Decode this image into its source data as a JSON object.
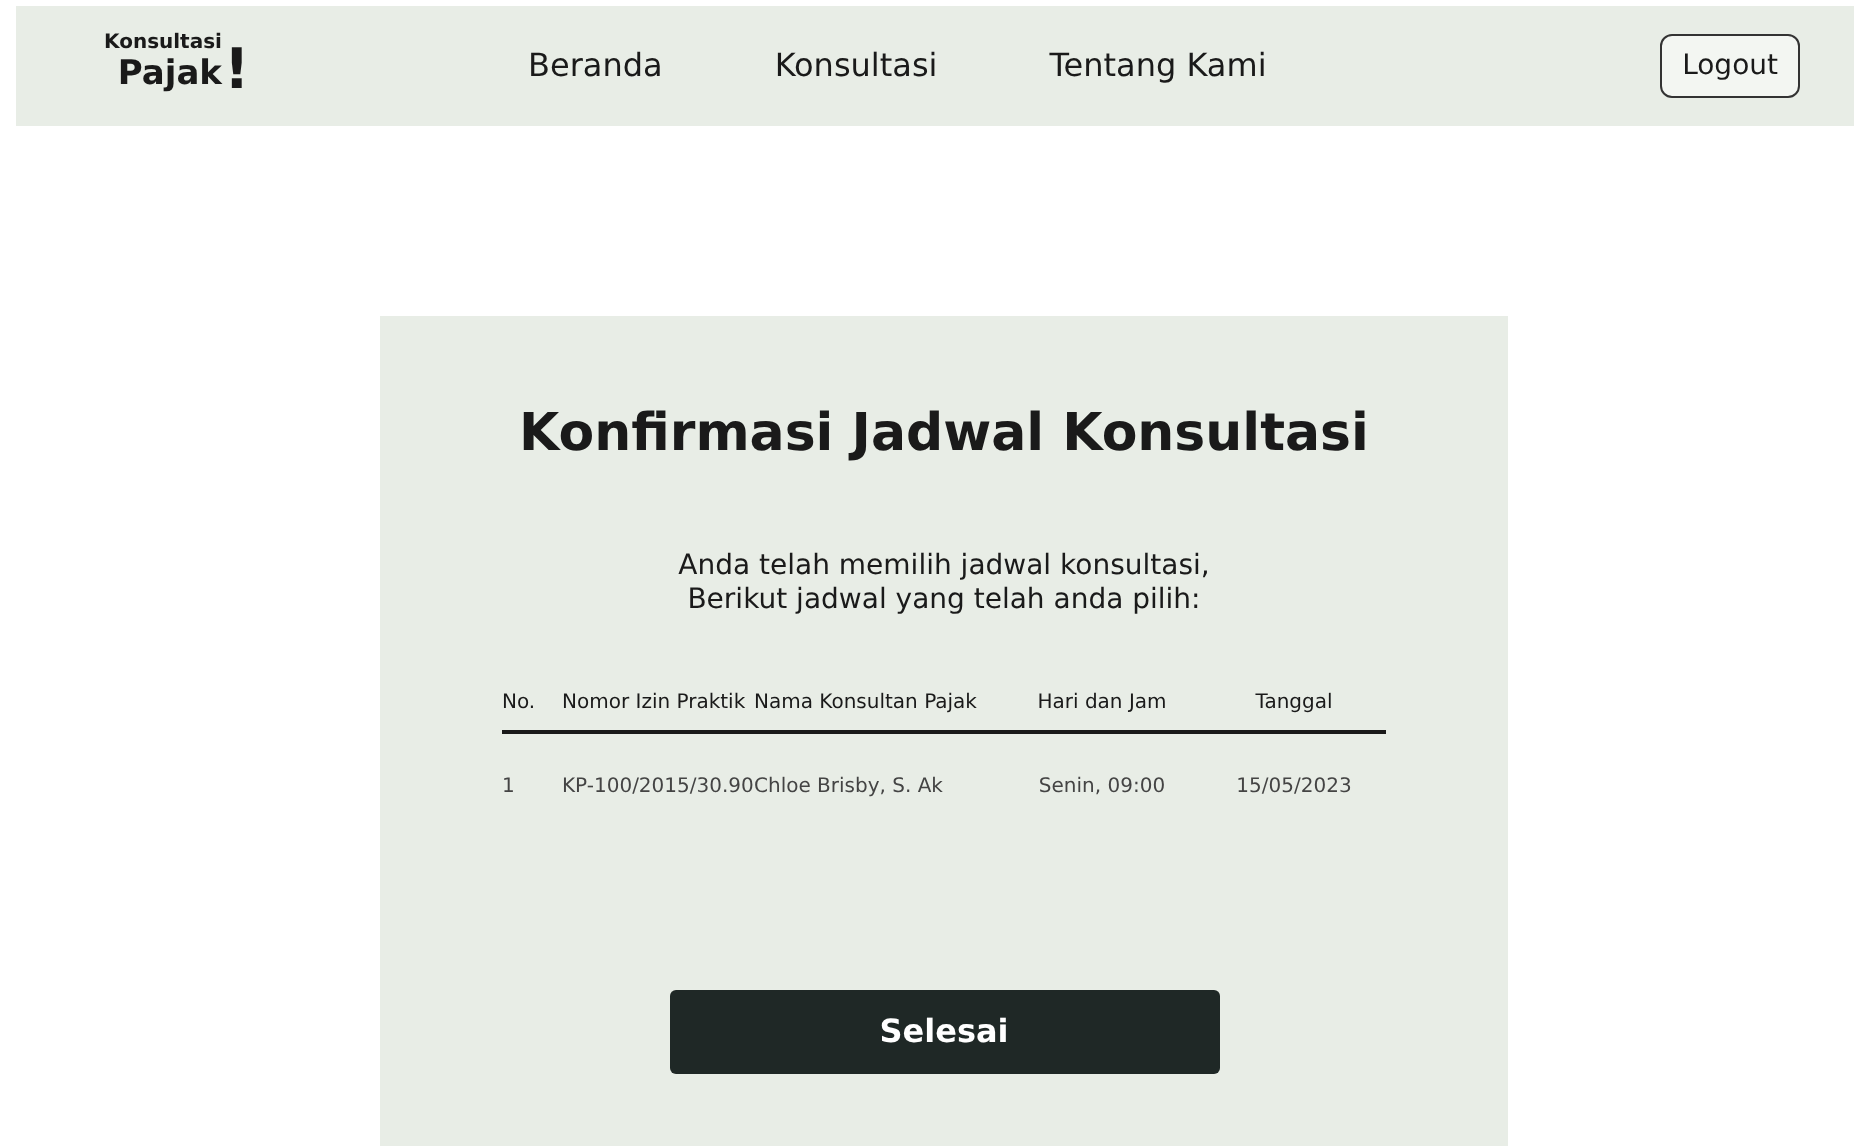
{
  "logo": {
    "top": "Konsultasi",
    "bottom": "Pajak",
    "mark": "!"
  },
  "nav": [
    "Beranda",
    "Konsultasi",
    "Tentang Kami"
  ],
  "logout": "Logout",
  "title": "Konfirmasi Jadwal Konsultasi",
  "intro": [
    "Anda telah memilih jadwal konsultasi,",
    "Berikut jadwal yang telah anda pilih:"
  ],
  "table": {
    "columns": [
      "No.",
      "Nomor Izin Praktik",
      "Nama Konsultan Pajak",
      "Hari dan Jam",
      "Tanggal"
    ],
    "rows": [
      [
        "1",
        "KP-100/2015/30.90",
        "Chloe Brisby, S. Ak",
        "Senin, 09:00",
        "15/05/2023"
      ]
    ]
  },
  "button": "Selesai"
}
